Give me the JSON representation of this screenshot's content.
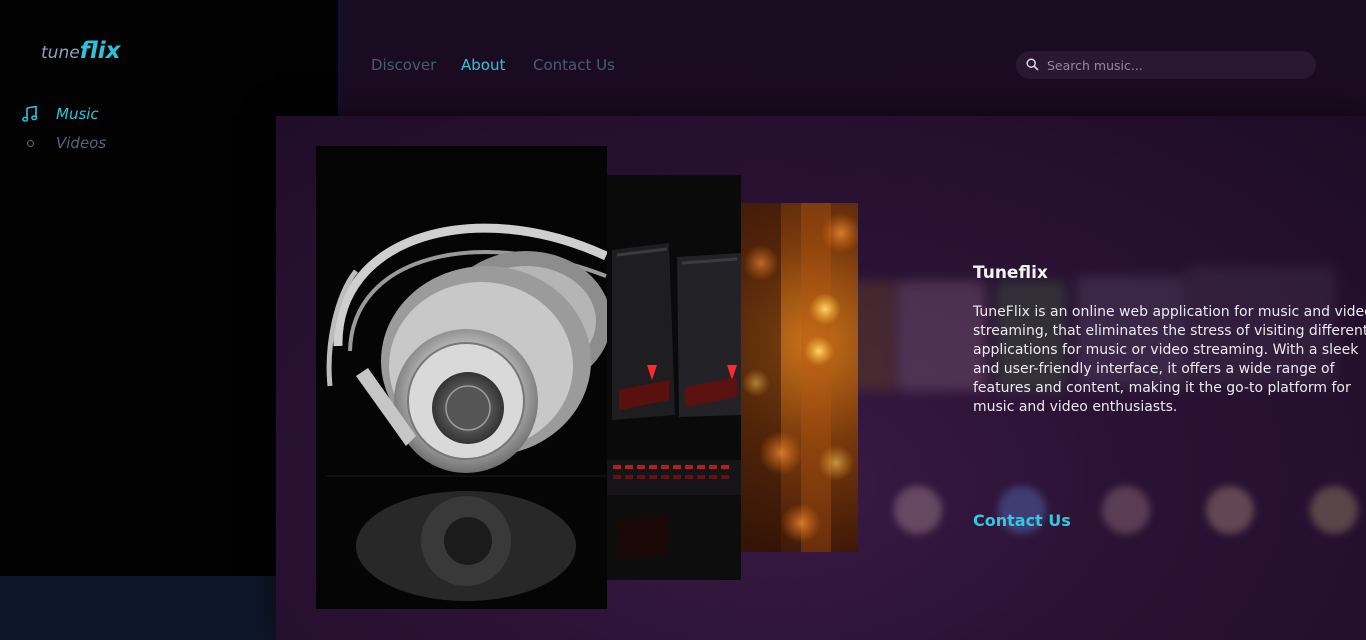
{
  "logo": {
    "prefix": "tune",
    "main": "flix"
  },
  "sidebar": {
    "items": [
      {
        "label": "Music",
        "icon": "music-note-icon",
        "active": true
      },
      {
        "label": "Videos",
        "icon": "circle-icon",
        "active": false
      }
    ]
  },
  "nav": {
    "discover": "Discover",
    "about": "About",
    "contact": "Contact Us"
  },
  "search": {
    "placeholder": "Search music..."
  },
  "about": {
    "title": "Tuneflix",
    "body": "TuneFlix is an online web application for music and video streaming, that eliminates the stress of visiting different applications for music or video streaming. With a sleek and user-friendly interface, it offers a wide range of features and content, making it the go-to platform for music and video enthusiasts.",
    "contact": "Contact Us"
  },
  "colors": {
    "accent": "#2ec3dc",
    "nav_inactive": "#4a5a73",
    "sidebar_bg": "#020203",
    "panel_bg": "#2a1234"
  }
}
